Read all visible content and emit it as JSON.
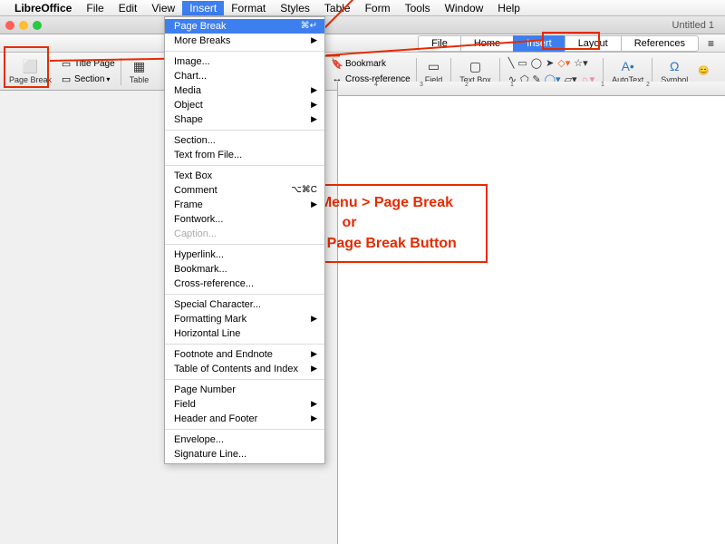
{
  "menubar": {
    "app": "LibreOffice",
    "items": [
      "File",
      "Edit",
      "View",
      "Insert",
      "Format",
      "Styles",
      "Table",
      "Form",
      "Tools",
      "Window",
      "Help"
    ]
  },
  "titlebar": {
    "doc": "Untitled 1"
  },
  "ribbon": {
    "tabs": [
      "File",
      "Home",
      "Insert",
      "Layout",
      "References"
    ]
  },
  "toolbar_left": {
    "page_break": "Page Break",
    "title_page": "Title Page",
    "section": "Section",
    "table": "Table"
  },
  "toolbar_right": {
    "bookmark": "Bookmark",
    "cross_ref": "Cross-reference",
    "field": "Field",
    "textbox": "Text Box",
    "autotext": "AutoText",
    "symbol": "Symbol"
  },
  "insert_menu": {
    "page_break": "Page Break",
    "page_break_kb": "⌘↵",
    "more_breaks": "More Breaks",
    "image": "Image...",
    "chart": "Chart...",
    "media": "Media",
    "object": "Object",
    "shape": "Shape",
    "section": "Section...",
    "text_file": "Text from File...",
    "textbox": "Text Box",
    "comment": "Comment",
    "comment_kb": "⌥⌘C",
    "frame": "Frame",
    "fontwork": "Fontwork...",
    "caption": "Caption...",
    "hyperlink": "Hyperlink...",
    "bookmark": "Bookmark...",
    "crossref": "Cross-reference...",
    "special": "Special Character...",
    "fmark": "Formatting Mark",
    "hline": "Horizontal Line",
    "footnote": "Footnote and Endnote",
    "toc": "Table of Contents and Index",
    "pagenum": "Page Number",
    "field": "Field",
    "headfoot": "Header and Footer",
    "envelope": "Envelope...",
    "sig": "Signature Line..."
  },
  "annotation": {
    "line1": "Use Insert Menu > Page Break",
    "line2": "or",
    "line3": "Insert Tab > Page Break Button"
  },
  "ruler_marks": [
    "4",
    "3",
    "2",
    "1",
    "",
    "1",
    "2"
  ]
}
